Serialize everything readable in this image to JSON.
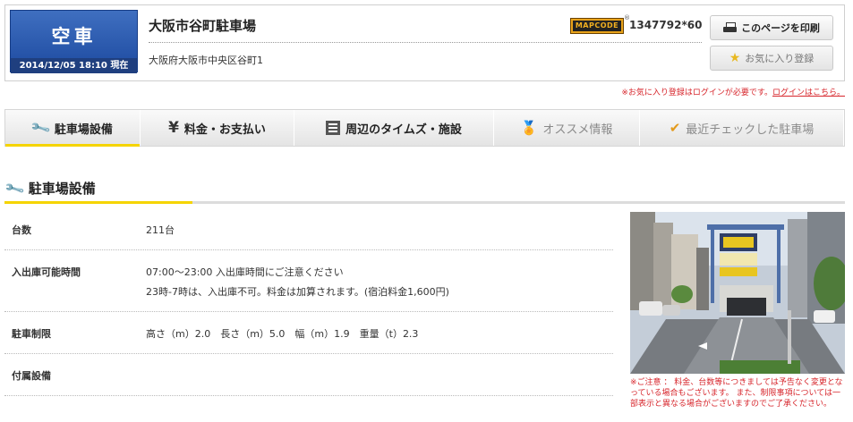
{
  "status": {
    "label": "空車",
    "timestamp": "2014/12/05 18:10 現在"
  },
  "lot": {
    "name": "大阪市谷町駐車場",
    "address": "大阪府大阪市中央区谷町1"
  },
  "mapcode": {
    "logo_text": "MAPCODE",
    "reg_mark": "®",
    "value": "1347792*60"
  },
  "buttons": {
    "print": "このページを印刷",
    "favorite": "お気に入り登録"
  },
  "login_note": {
    "text": "※お気に入り登録はログインが必要です。",
    "link": "ログインはこちら。"
  },
  "tabs": [
    {
      "label": "駐車場設備",
      "icon": "wrench-icon"
    },
    {
      "label": "料金・お支払い",
      "icon": "yen-icon"
    },
    {
      "label": "周辺のタイムズ・施設",
      "icon": "building-icon"
    },
    {
      "label": "オススメ情報",
      "icon": "medal-icon"
    },
    {
      "label": "最近チェックした駐車場",
      "icon": "check-icon"
    }
  ],
  "section": {
    "title": "駐車場設備",
    "rows": [
      {
        "label": "台数",
        "value": [
          "211台"
        ]
      },
      {
        "label": "入出庫可能時間",
        "value": [
          "07:00～23:00 入出庫時間にご注意ください",
          "23時-7時は、入出庫不可。料金は加算されます。(宿泊料金1,600円)"
        ]
      },
      {
        "label": "駐車制限",
        "value": [
          "高さ（m）2.0　長さ（m）5.0　幅（m）1.9　重量（t）2.3"
        ]
      },
      {
        "label": "付属設備",
        "value": [
          ""
        ]
      }
    ]
  },
  "photo_caution": "※ご注意 ： 料金、台数等につきましては予告なく変更となっている場合もございます。 また、制限事項については一部表示と異なる場合がございますのでご了承ください。",
  "colors": {
    "status_blue": "#1d4aa0",
    "accent_yellow": "#f5d400",
    "notice_red": "#d7262c"
  }
}
